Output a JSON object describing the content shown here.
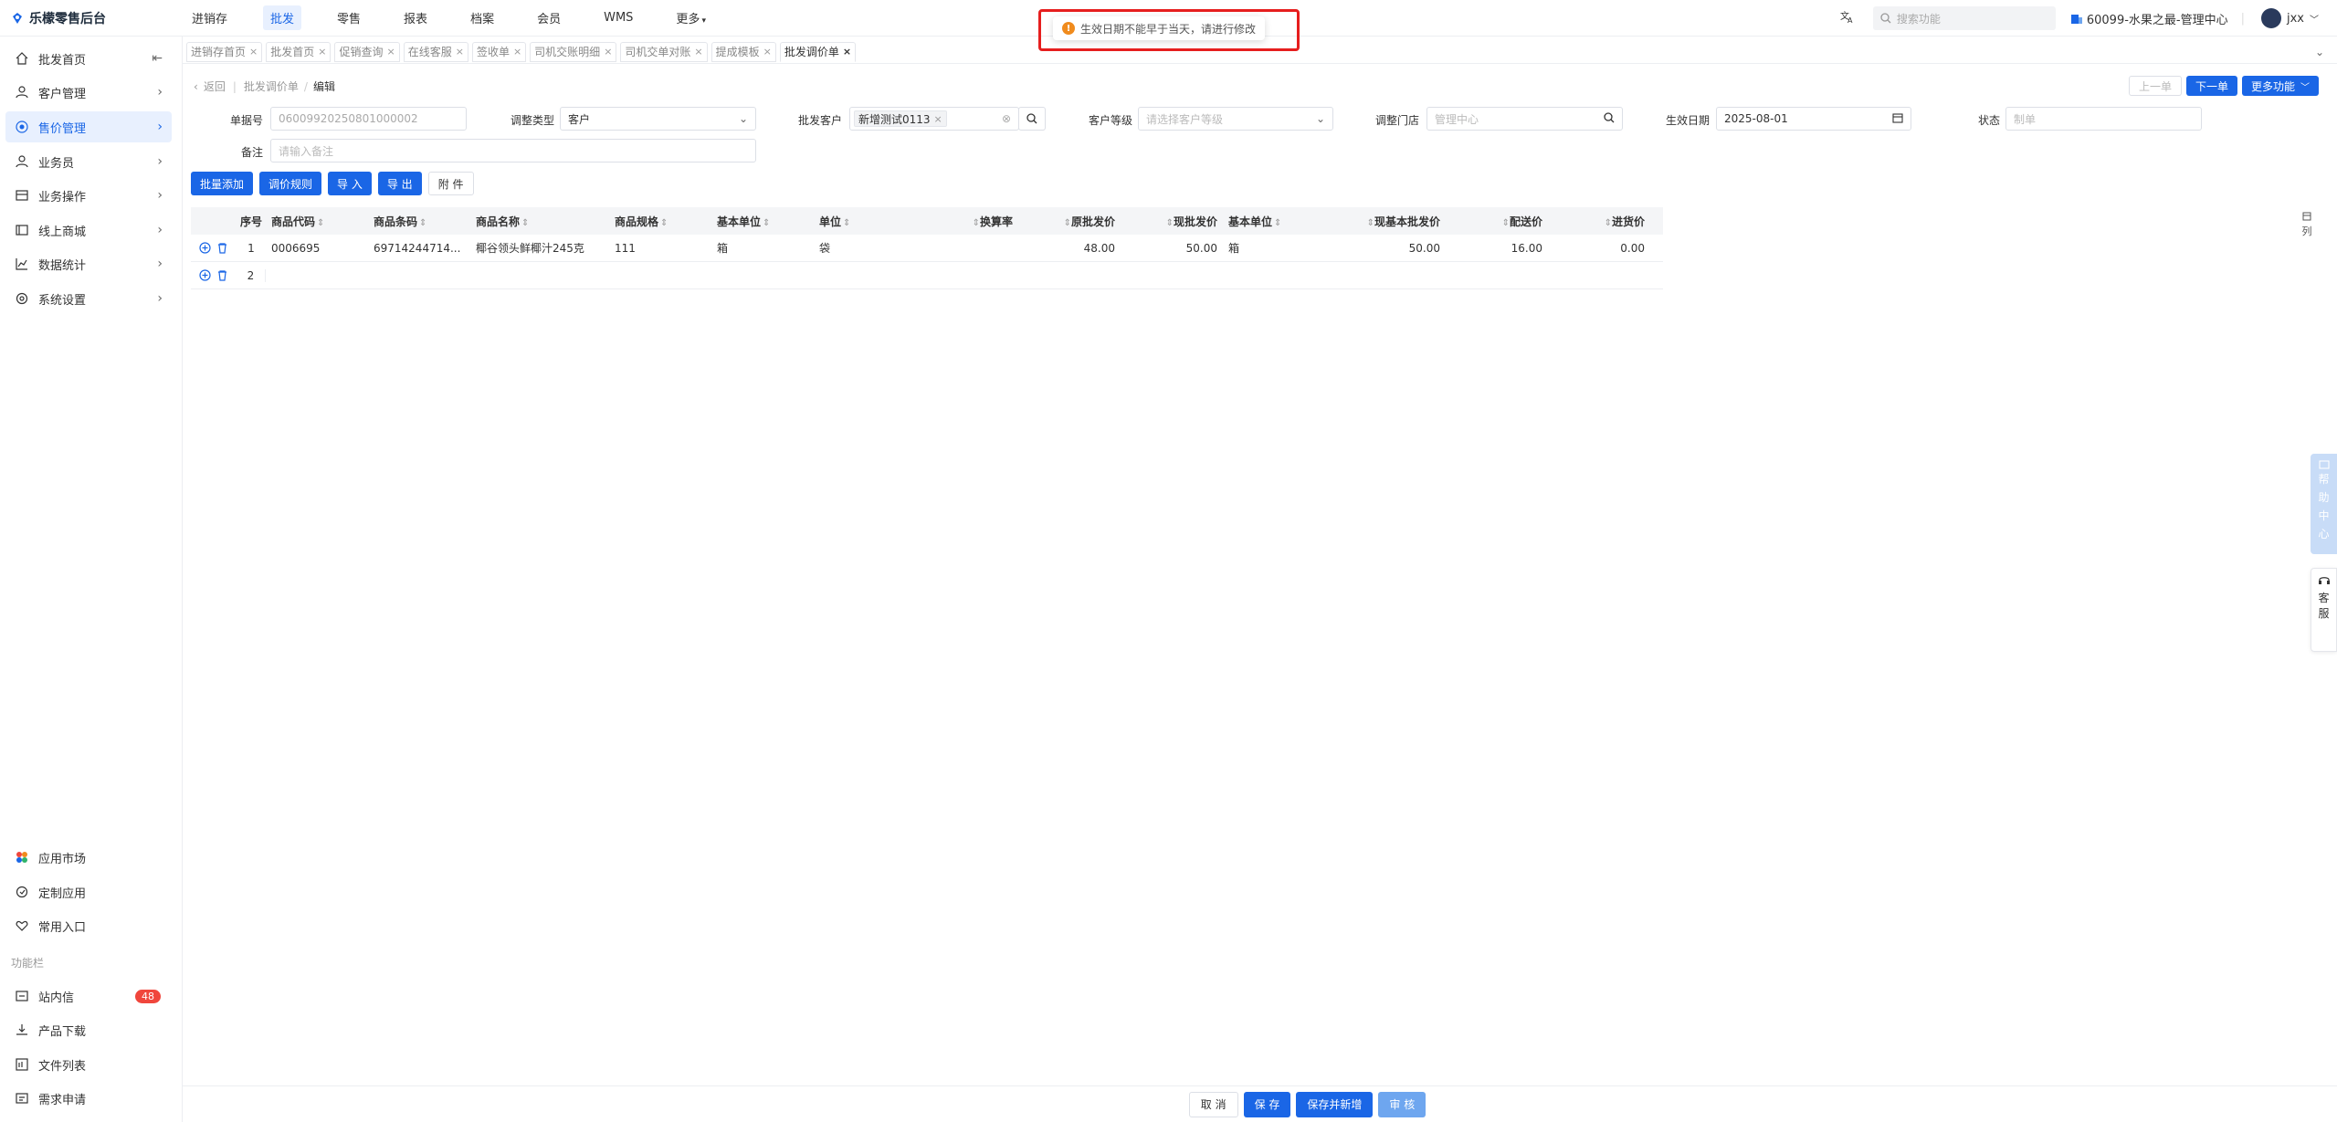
{
  "app": {
    "name": "乐檬零售后台"
  },
  "topnav": [
    {
      "label": "进销存",
      "active": false
    },
    {
      "label": "批发",
      "active": true
    },
    {
      "label": "零售",
      "active": false
    },
    {
      "label": "报表",
      "active": false
    },
    {
      "label": "档案",
      "active": false
    },
    {
      "label": "会员",
      "active": false
    },
    {
      "label": "WMS",
      "active": false
    },
    {
      "label": "更多",
      "active": false
    }
  ],
  "search": {
    "placeholder": "搜索功能"
  },
  "org": {
    "label": "60099-水果之最-管理中心"
  },
  "user": {
    "name": "jxx"
  },
  "toast": {
    "message": "生效日期不能早于当天，请进行修改"
  },
  "sidebar": {
    "items": [
      {
        "label": "批发首页",
        "icon": "home-icon"
      },
      {
        "label": "客户管理",
        "icon": "user-icon"
      },
      {
        "label": "售价管理",
        "icon": "price-icon",
        "active": true
      },
      {
        "label": "业务员",
        "icon": "person-icon"
      },
      {
        "label": "业务操作",
        "icon": "operation-icon"
      },
      {
        "label": "线上商城",
        "icon": "shop-icon"
      },
      {
        "label": "数据统计",
        "icon": "chart-icon"
      },
      {
        "label": "系统设置",
        "icon": "settings-icon"
      }
    ],
    "bottom": [
      {
        "label": "应用市场"
      },
      {
        "label": "定制应用"
      },
      {
        "label": "常用入口"
      }
    ],
    "section_title": "功能栏",
    "tools": [
      {
        "label": "站内信",
        "badge": "48"
      },
      {
        "label": "产品下载"
      },
      {
        "label": "文件列表"
      },
      {
        "label": "需求申请"
      }
    ]
  },
  "tabs": [
    {
      "label": "进销存首页"
    },
    {
      "label": "批发首页"
    },
    {
      "label": "促销查询"
    },
    {
      "label": "在线客服"
    },
    {
      "label": "签收单"
    },
    {
      "label": "司机交账明细"
    },
    {
      "label": "司机交单对账"
    },
    {
      "label": "提成模板"
    },
    {
      "label": "批发调价单",
      "active": true
    }
  ],
  "breadcrumb": {
    "back": "返回",
    "parent": "批发调价单",
    "current": "编辑"
  },
  "header_buttons": {
    "prev": "上一单",
    "next": "下一单",
    "more": "更多功能"
  },
  "form": {
    "doc_no_label": "单据号",
    "doc_no_value": "06009920250801000002",
    "adjust_type_label": "调整类型",
    "adjust_type_value": "客户",
    "customer_label": "批发客户",
    "customer_tag": "新增测试0113",
    "level_label": "客户等级",
    "level_placeholder": "请选择客户等级",
    "store_label": "调整门店",
    "store_placeholder": "管理中心",
    "date_label": "生效日期",
    "date_value": "2025-08-01",
    "status_label": "状态",
    "status_placeholder": "制单",
    "remark_label": "备注",
    "remark_placeholder": "请输入备注"
  },
  "actions": {
    "batch_add": "批量添加",
    "rule": "调价规则",
    "import": "导 入",
    "export": "导 出",
    "attach": "附 件"
  },
  "table": {
    "headers": {
      "seq": "序号",
      "code": "商品代码",
      "barcode": "商品条码",
      "name": "商品名称",
      "spec": "商品规格",
      "base_unit": "基本单位",
      "unit": "单位",
      "rate": "换算率",
      "orig_price": "原批发价",
      "new_price": "现批发价",
      "base_unit2": "基本单位",
      "new_base_price": "现基本批发价",
      "dist_price": "配送价",
      "purchase_price": "进货价"
    },
    "rows": [
      {
        "seq": "1",
        "code": "0006695",
        "barcode": "69714244714...",
        "name": "椰谷领头鲜椰汁245克",
        "spec": "111",
        "base_unit": "箱",
        "unit": "袋",
        "rate": "",
        "orig_price": "48.00",
        "new_price": "50.00",
        "base_unit2": "箱",
        "new_base_price": "50.00",
        "dist_price": "16.00",
        "purchase_price": "0.00"
      },
      {
        "seq": "2",
        "code": "",
        "barcode": "",
        "name": "",
        "spec": "",
        "base_unit": "",
        "unit": "",
        "rate": "",
        "orig_price": "",
        "new_price": "",
        "base_unit2": "",
        "new_base_price": "",
        "dist_price": "",
        "purchase_price": ""
      }
    ]
  },
  "right_rail": {
    "columns": "列",
    "help": [
      "帮",
      "助",
      "中",
      "心"
    ],
    "service": [
      "客",
      "服"
    ]
  },
  "footer": {
    "cancel": "取 消",
    "save": "保 存",
    "save_new": "保存并新增",
    "audit": "审 核"
  },
  "colors": {
    "primary": "#1a66e6",
    "active_bg": "#e8f0fe",
    "badge": "#f0463c",
    "warning": "#f08b1d",
    "highlight_border": "#e61e1e"
  }
}
